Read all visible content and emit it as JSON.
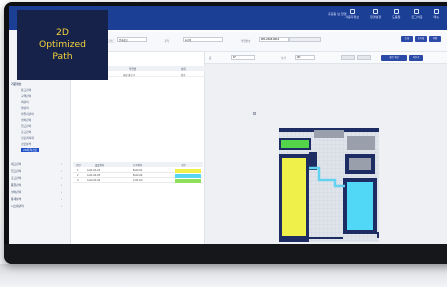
{
  "badge": {
    "line1": "2D",
    "line2": "Optimized",
    "line3": "Path"
  },
  "top_nav": [
    {
      "icon": "search-icon",
      "label": "사용자정보"
    },
    {
      "icon": "setting-icon",
      "label": "환경설정"
    },
    {
      "icon": "help-icon",
      "label": "도움말"
    },
    {
      "icon": "logout-icon",
      "label": "로그아웃"
    },
    {
      "icon": "menu-icon",
      "label": "메뉴"
    }
  ],
  "user_chip": "홍길동 님 환영",
  "subbar": {
    "label_1": "창고코드",
    "value_1": "본사창고",
    "label_2": "구역",
    "value_2": "A구역",
    "label_3": "작업번호",
    "value_3": "WO-2024-0012",
    "btn_search": "조회",
    "btn_reset": "초기화",
    "btn_save": "저장"
  },
  "sidebar": {
    "items": [
      {
        "label": "기준정보",
        "sub": false
      },
      {
        "label": "창고관리",
        "sub": true
      },
      {
        "label": "구역관리",
        "sub": true
      },
      {
        "label": "랙관리",
        "sub": true
      },
      {
        "label": "셀관리",
        "sub": true
      },
      {
        "label": "작업자관리",
        "sub": true
      },
      {
        "label": "설비관리",
        "sub": true
      },
      {
        "label": "입고관리",
        "sub": true
      },
      {
        "label": "출고관리",
        "sub": true
      },
      {
        "label": "경로최적화",
        "sub": true
      },
      {
        "label": "경로분석",
        "sub": true
      },
      {
        "label": "2D최적경로",
        "sub": true,
        "active": true
      }
    ],
    "groups": [
      "재고관리",
      "입고관리",
      "출고관리",
      "품질관리",
      "설비관리",
      "통계분석",
      "시스템관리"
    ]
  },
  "left_panel": {
    "head_col_1": "번호",
    "head_col_2": "작업명",
    "head_col_3": "상태",
    "row": {
      "no": "1",
      "name": "피킹 경로 A",
      "status": "완료"
    },
    "table_headers": [
      "순번",
      "출발위치",
      "도착위치",
      "구분"
    ],
    "table_rows": [
      {
        "seq": "1",
        "from": "A-01-01-01",
        "to": "B-02-01",
        "color": "#f0f04a"
      },
      {
        "seq": "2",
        "from": "A-01-02-03",
        "to": "B-02-04",
        "color": "#56d6f0"
      },
      {
        "seq": "3",
        "from": "A-02-01-02",
        "to": "C-01-02",
        "color": "#8ee05a"
      }
    ]
  },
  "canvas": {
    "label_floor": "층",
    "floor_value": "1F",
    "label_view": "보기",
    "view_value": "2D",
    "btn_route": "경로 계산",
    "btn_clear": "지우기"
  }
}
